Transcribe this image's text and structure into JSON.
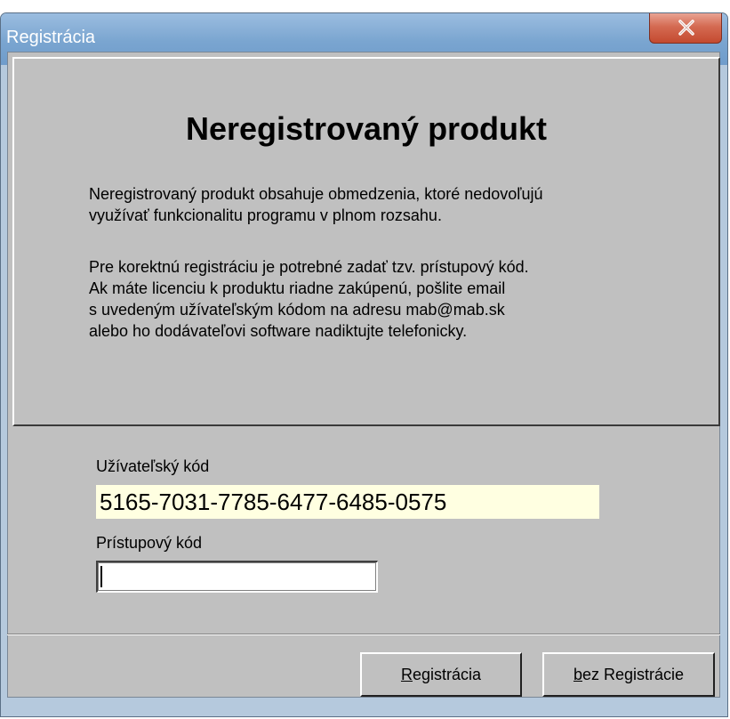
{
  "window": {
    "title": "Registrácia",
    "close_icon": "close-x-icon",
    "titlebar_color": "#7aa5d0",
    "close_color": "#c44a2f"
  },
  "info": {
    "heading": "Neregistrovaný produkt",
    "paragraph1_lines": [
      "Neregistrovaný produkt obsahuje obmedzenia, ktoré nedovoľujú",
      "využívať funkcionalitu programu v plnom rozsahu."
    ],
    "paragraph2_lines": [
      "Pre korektnú registráciu je potrebné zadať tzv. prístupový kód.",
      "Ak máte licenciu k produktu riadne zakúpenú, pošlite email",
      "s uvedeným užívateľským kódom na adresu mab@mab.sk",
      "alebo ho dodávateľovi software nadiktujte telefonicky."
    ]
  },
  "form": {
    "user_code_label": "Užívateľský kód",
    "user_code_value": "5165-7031-7785-6477-6485-0575",
    "user_code_bg": "#ffffe1",
    "access_code_label": "Prístupový kód",
    "access_code_value": ""
  },
  "buttons": {
    "register_mnemonic": "R",
    "register_rest": "egistrácia",
    "skip_mnemonic": "b",
    "skip_rest": "ez Registrácie"
  }
}
